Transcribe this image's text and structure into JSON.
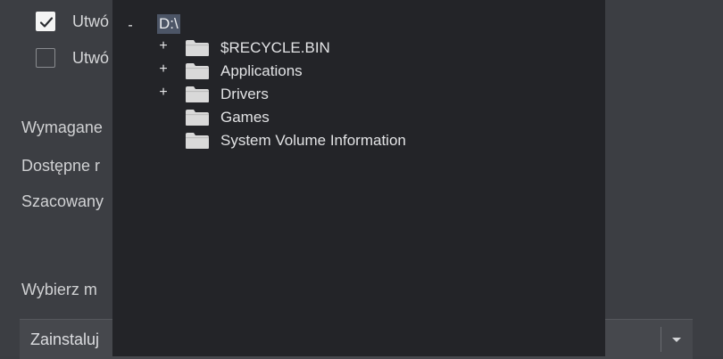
{
  "dialog": {
    "checkbox1": {
      "label": "Utwó",
      "checked": true
    },
    "checkbox2": {
      "label": "Utwó",
      "checked": false
    },
    "info": [
      "Wymagane",
      "Dostępne r",
      "Szacowany"
    ],
    "select_location_label": "Wybierz m",
    "install_dropdown": {
      "value": "Zainstaluj"
    }
  },
  "folder_browser": {
    "root": {
      "toggle": "-",
      "label": "D:\\"
    },
    "items": [
      {
        "toggle": "+",
        "label": "$RECYCLE.BIN",
        "expandable": true
      },
      {
        "toggle": "+",
        "label": "Applications",
        "expandable": true
      },
      {
        "toggle": "+",
        "label": "Drivers",
        "expandable": true
      },
      {
        "toggle": "",
        "label": "Games",
        "expandable": false
      },
      {
        "toggle": "",
        "label": "System Volume Information",
        "expandable": false
      }
    ]
  },
  "icons": {
    "check": "check-icon",
    "folder": "folder-icon",
    "dropdown": "chevron-down-icon"
  },
  "colors": {
    "background": "#3c3e43",
    "tree_background": "#232428",
    "root_highlight": "#4c5566",
    "folder": "#d9d9d9"
  }
}
